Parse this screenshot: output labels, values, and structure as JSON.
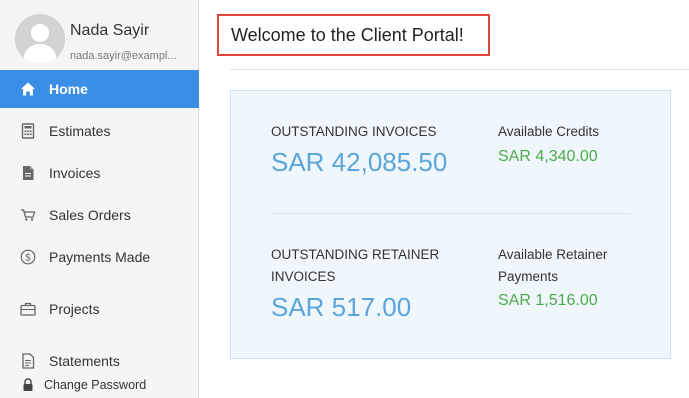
{
  "user": {
    "name": "Nada Sayir",
    "email": "nada.sayir@exampl..."
  },
  "sidebar": {
    "items": [
      {
        "label": "Home",
        "icon": "home-icon",
        "active": true
      },
      {
        "label": "Estimates",
        "icon": "calculator-icon"
      },
      {
        "label": "Invoices",
        "icon": "document-icon"
      },
      {
        "label": "Sales Orders",
        "icon": "cart-icon"
      },
      {
        "label": "Payments Made",
        "icon": "dollar-circle-icon"
      },
      {
        "label": "Projects",
        "icon": "briefcase-icon"
      },
      {
        "label": "Statements",
        "icon": "statement-icon"
      },
      {
        "label": "Change Password",
        "icon": "lock-icon"
      }
    ]
  },
  "main": {
    "welcome": "Welcome to the Client Portal!",
    "summary": {
      "outstanding_invoices_label": "OUTSTANDING INVOICES",
      "outstanding_invoices_amount": "SAR 42,085.50",
      "available_credits_label": "Available Credits",
      "available_credits_amount": "SAR 4,340.00",
      "retainer_label_line1": "OUTSTANDING RETAINER",
      "retainer_label_line2": "INVOICES",
      "retainer_amount": "SAR 517.00",
      "retainer_payments_label_line1": "Available Retainer",
      "retainer_payments_label_line2": "Payments",
      "retainer_payments_amount": "SAR 1,516.00"
    }
  },
  "colors": {
    "active_nav": "#3a8ee6",
    "amount_blue": "#5aa6dc",
    "amount_green": "#4caa4c",
    "highlight_border": "#e0443a"
  }
}
